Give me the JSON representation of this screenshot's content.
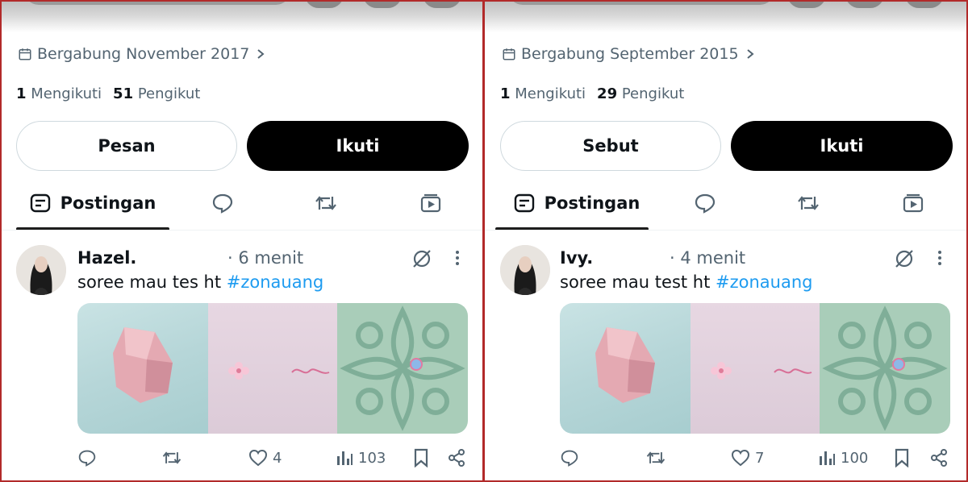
{
  "colors": {
    "frame": "#b22a2a",
    "text_primary": "#0f1419",
    "text_secondary": "#536471",
    "hashtag": "#1d9bf0",
    "follow_button": "#000000"
  },
  "panels": [
    {
      "join_label": "Bergabung November 2017",
      "following_count": "1",
      "following_label": "Mengikuti",
      "followers_count": "51",
      "followers_label": "Pengikut",
      "secondary_button": "Pesan",
      "follow_button": "Ikuti",
      "tabs": {
        "posts_label": "Postingan"
      },
      "post": {
        "author": "Hazel.",
        "time": "· 6 menit",
        "text": "soree mau tes ht ",
        "hashtag": "#zonauang",
        "likes": "4",
        "views": "103"
      }
    },
    {
      "join_label": "Bergabung September 2015",
      "following_count": "1",
      "following_label": "Mengikuti",
      "followers_count": "29",
      "followers_label": "Pengikut",
      "secondary_button": "Sebut",
      "follow_button": "Ikuti",
      "tabs": {
        "posts_label": "Postingan"
      },
      "post": {
        "author": "Ivy.",
        "time": "· 4 menit",
        "text": "soree mau test ht ",
        "hashtag": "#zonauang",
        "likes": "7",
        "views": "100"
      }
    }
  ],
  "icons": [
    "calendar-icon",
    "chevron-right-icon",
    "posts-tab-icon",
    "replies-tab-icon",
    "reposts-tab-icon",
    "media-tab-icon",
    "grok-icon",
    "more-icon",
    "reply-icon",
    "repost-icon",
    "like-icon",
    "views-icon",
    "bookmark-icon",
    "share-icon"
  ]
}
